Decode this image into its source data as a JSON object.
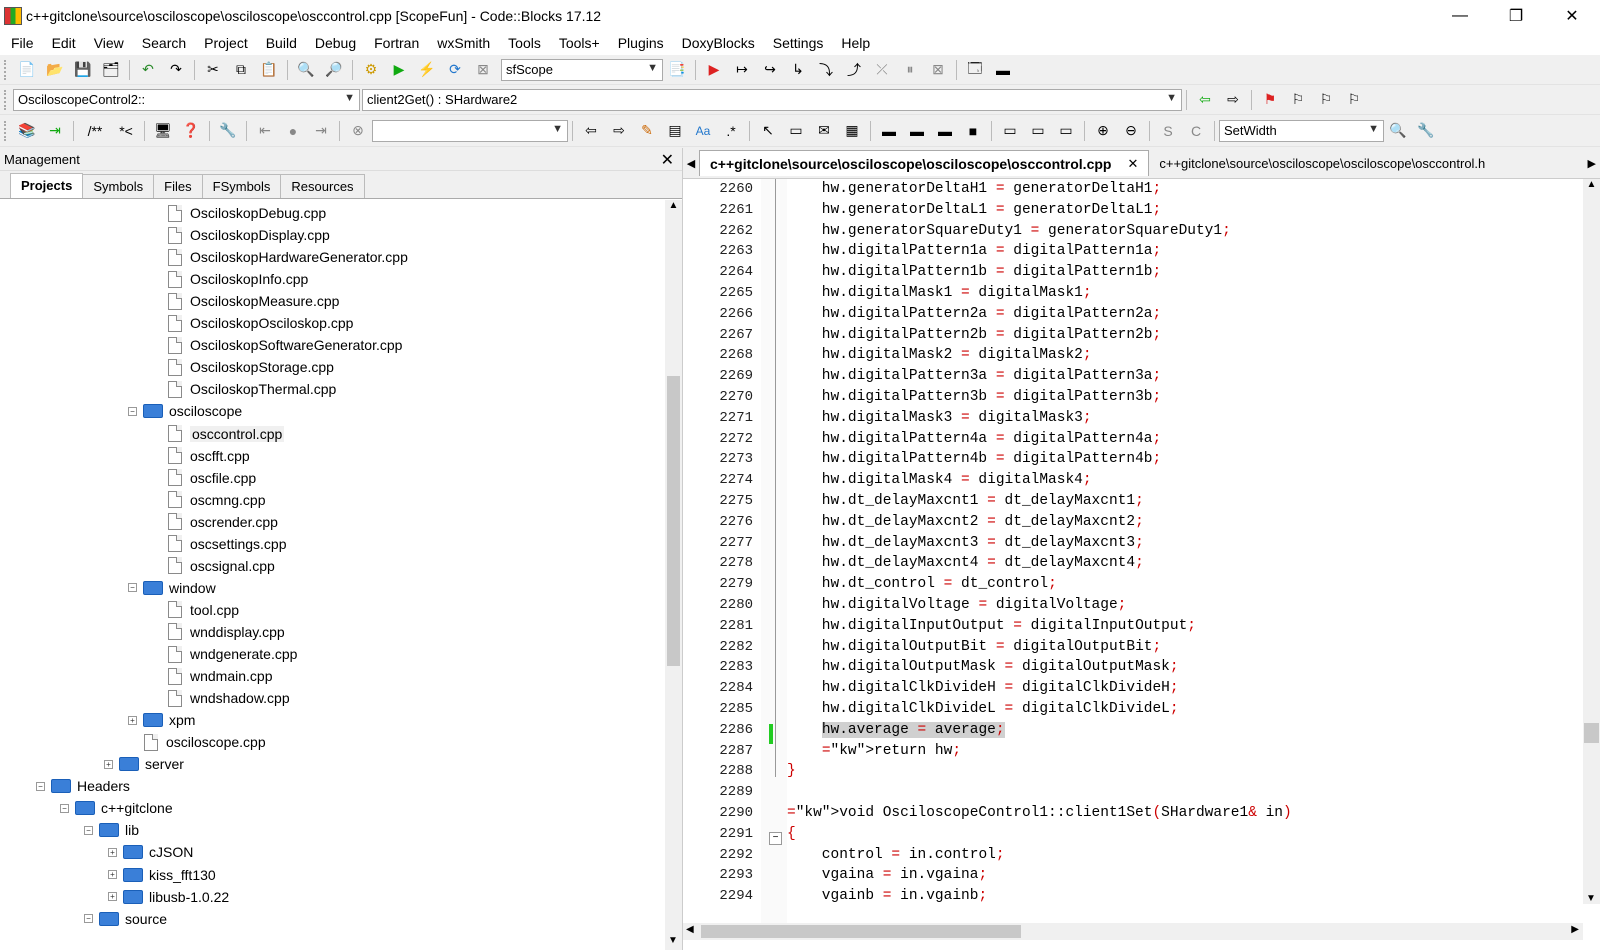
{
  "window": {
    "title": "c++gitclone\\source\\osciloscope\\osciloscope\\osccontrol.cpp [ScopeFun] - Code::Blocks 17.12",
    "minimize": "—",
    "restore": "❐",
    "close": "✕"
  },
  "menu": [
    "File",
    "Edit",
    "View",
    "Search",
    "Project",
    "Build",
    "Debug",
    "Fortran",
    "wxSmith",
    "Tools",
    "Tools+",
    "Plugins",
    "DoxyBlocks",
    "Settings",
    "Help"
  ],
  "toolbar1": {
    "build_target": "sfScope"
  },
  "toolbar2": {
    "scope": "OsciloscopeControl2::",
    "function": "client2Get() : SHardware2"
  },
  "toolbar3": {
    "comment1": "/**",
    "comment2": "*<",
    "search_value": "",
    "wx_combo": "SetWidth"
  },
  "management": {
    "title": "Management",
    "tabs": [
      "Projects",
      "Symbols",
      "Files",
      "FSymbols",
      "Resources"
    ]
  },
  "tree": [
    {
      "label": "OsciloskopDebug.cpp"
    },
    {
      "label": "OsciloskopDisplay.cpp"
    },
    {
      "label": "OsciloskopHardwareGenerator.cpp"
    },
    {
      "label": "OsciloskopInfo.cpp"
    },
    {
      "label": "OsciloskopMeasure.cpp"
    },
    {
      "label": "OsciloskopOsciloskop.cpp"
    },
    {
      "label": "OsciloskopSoftwareGenerator.cpp"
    },
    {
      "label": "OsciloskopStorage.cpp"
    },
    {
      "label": "OsciloskopThermal.cpp"
    },
    {
      "label": "osciloscope"
    },
    {
      "label": "osccontrol.cpp"
    },
    {
      "label": "oscfft.cpp"
    },
    {
      "label": "oscfile.cpp"
    },
    {
      "label": "oscmng.cpp"
    },
    {
      "label": "oscrender.cpp"
    },
    {
      "label": "oscsettings.cpp"
    },
    {
      "label": "oscsignal.cpp"
    },
    {
      "label": "window"
    },
    {
      "label": "tool.cpp"
    },
    {
      "label": "wnddisplay.cpp"
    },
    {
      "label": "wndgenerate.cpp"
    },
    {
      "label": "wndmain.cpp"
    },
    {
      "label": "wndshadow.cpp"
    },
    {
      "label": "xpm"
    },
    {
      "label": "osciloscope.cpp"
    },
    {
      "label": "server"
    },
    {
      "label": "Headers"
    },
    {
      "label": "c++gitclone"
    },
    {
      "label": "lib"
    },
    {
      "label": "cJSON"
    },
    {
      "label": "kiss_fft130"
    },
    {
      "label": "libusb-1.0.22"
    },
    {
      "label": "source"
    }
  ],
  "editor": {
    "tabs": [
      "c++gitclone\\source\\osciloscope\\osciloscope\\osccontrol.cpp",
      "c++gitclone\\source\\osciloscope\\osciloscope\\osccontrol.h"
    ],
    "tab_close": "✕",
    "lines": [
      {
        "n": "2260",
        "t": "    hw.generatorDeltaH1 = generatorDeltaH1;"
      },
      {
        "n": "2261",
        "t": "    hw.generatorDeltaL1 = generatorDeltaL1;"
      },
      {
        "n": "2262",
        "t": "    hw.generatorSquareDuty1 = generatorSquareDuty1;"
      },
      {
        "n": "2263",
        "t": "    hw.digitalPattern1a = digitalPattern1a;"
      },
      {
        "n": "2264",
        "t": "    hw.digitalPattern1b = digitalPattern1b;"
      },
      {
        "n": "2265",
        "t": "    hw.digitalMask1 = digitalMask1;"
      },
      {
        "n": "2266",
        "t": "    hw.digitalPattern2a = digitalPattern2a;"
      },
      {
        "n": "2267",
        "t": "    hw.digitalPattern2b = digitalPattern2b;"
      },
      {
        "n": "2268",
        "t": "    hw.digitalMask2 = digitalMask2;"
      },
      {
        "n": "2269",
        "t": "    hw.digitalPattern3a = digitalPattern3a;"
      },
      {
        "n": "2270",
        "t": "    hw.digitalPattern3b = digitalPattern3b;"
      },
      {
        "n": "2271",
        "t": "    hw.digitalMask3 = digitalMask3;"
      },
      {
        "n": "2272",
        "t": "    hw.digitalPattern4a = digitalPattern4a;"
      },
      {
        "n": "2273",
        "t": "    hw.digitalPattern4b = digitalPattern4b;"
      },
      {
        "n": "2274",
        "t": "    hw.digitalMask4 = digitalMask4;"
      },
      {
        "n": "2275",
        "t": "    hw.dt_delayMaxcnt1 = dt_delayMaxcnt1;"
      },
      {
        "n": "2276",
        "t": "    hw.dt_delayMaxcnt2 = dt_delayMaxcnt2;"
      },
      {
        "n": "2277",
        "t": "    hw.dt_delayMaxcnt3 = dt_delayMaxcnt3;"
      },
      {
        "n": "2278",
        "t": "    hw.dt_delayMaxcnt4 = dt_delayMaxcnt4;"
      },
      {
        "n": "2279",
        "t": "    hw.dt_control = dt_control;"
      },
      {
        "n": "2280",
        "t": "    hw.digitalVoltage = digitalVoltage;"
      },
      {
        "n": "2281",
        "t": "    hw.digitalInputOutput = digitalInputOutput;"
      },
      {
        "n": "2282",
        "t": "    hw.digitalOutputBit = digitalOutputBit;"
      },
      {
        "n": "2283",
        "t": "    hw.digitalOutputMask = digitalOutputMask;"
      },
      {
        "n": "2284",
        "t": "    hw.digitalClkDivideH = digitalClkDivideH;"
      },
      {
        "n": "2285",
        "t": "    hw.digitalClkDivideL = digitalClkDivideL;"
      },
      {
        "n": "2286",
        "t": "    hw.average = average;"
      },
      {
        "n": "2287",
        "t": "    return hw;"
      },
      {
        "n": "2288",
        "t": "}"
      },
      {
        "n": "2289",
        "t": ""
      },
      {
        "n": "2290",
        "t": "void OsciloscopeControl1::client1Set(SHardware1& in)"
      },
      {
        "n": "2291",
        "t": "{"
      },
      {
        "n": "2292",
        "t": "    control = in.control;"
      },
      {
        "n": "2293",
        "t": "    vgaina = in.vgaina;"
      },
      {
        "n": "2294",
        "t": "    vgainb = in.vgainb;"
      }
    ],
    "highlight_line": "2286"
  }
}
